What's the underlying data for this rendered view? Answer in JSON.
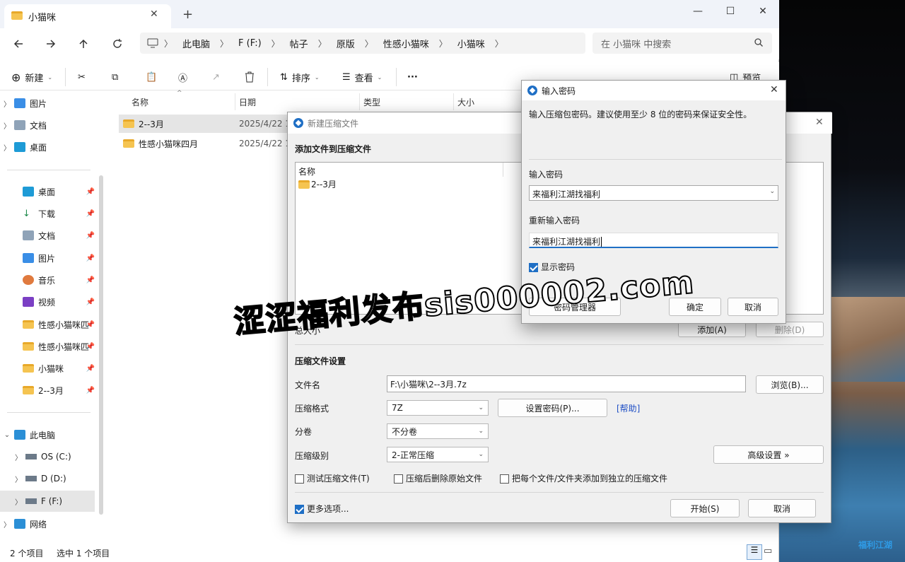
{
  "explorer": {
    "tab_title": "小猫咪",
    "breadcrumb": [
      "此电脑",
      "F (F:)",
      "帖子",
      "原版",
      "性感小猫咪",
      "小猫咪"
    ],
    "search_placeholder": "在 小猫咪 中搜索",
    "toolbar": {
      "new_label": "新建",
      "sort_label": "排序",
      "view_label": "查看",
      "more_label": "···",
      "preview_label": "预览"
    },
    "nav_top": [
      "图片",
      "文档",
      "桌面"
    ],
    "quick_access": [
      "桌面",
      "下载",
      "文档",
      "图片",
      "音乐",
      "视频",
      "性感小猫咪匹",
      "性感小猫咪匹",
      "小猫咪",
      "2--3月"
    ],
    "this_pc": {
      "label": "此电脑",
      "drives": [
        "OS (C:)",
        "D (D:)",
        "F (F:)"
      ],
      "network": "网络"
    },
    "columns": [
      "名称",
      "日期",
      "类型",
      "大小"
    ],
    "files": [
      {
        "name": "2--3月",
        "date": "2025/4/22 1"
      },
      {
        "name": "性感小猫咪四月",
        "date": "2025/4/22 1"
      }
    ],
    "status_count": "2 个项目",
    "status_selected": "选中 1 个项目"
  },
  "compress_dialog": {
    "title": "新建压缩文件",
    "heading": "添加文件到压缩文件",
    "list_header": "名称",
    "list_items": [
      "2--3月"
    ],
    "total_label": "总大小",
    "add_button": "添加(A)",
    "remove_button": "删除(D)",
    "settings_heading": "压缩文件设置",
    "filename_label": "文件名",
    "filename_value": "F:\\小猫咪\\2--3月.7z",
    "browse_button": "浏览(B)...",
    "format_label": "压缩格式",
    "format_value": "7Z",
    "set_password_button": "设置密码(P)...",
    "help_link": "[帮助]",
    "volume_label": "分卷",
    "volume_value": "不分卷",
    "level_label": "压缩级别",
    "level_value": "2-正常压缩",
    "advanced_button": "高级设置 »",
    "opt_test": "测试压缩文件(T)",
    "opt_delete": "压缩后删除原始文件",
    "opt_separate": "把每个文件/文件夹添加到独立的压缩文件",
    "more_options": "更多选项...",
    "start_button": "开始(S)",
    "cancel_button": "取消"
  },
  "password_dialog": {
    "title": "输入密码",
    "description": "输入压缩包密码。建议使用至少 8 位的密码来保证安全性。",
    "enter_label": "输入密码",
    "enter_value": "来福利江湖找福利",
    "reenter_label": "重新输入密码",
    "reenter_value": "来福利江湖找福利",
    "show_password": "显示密码",
    "manager_button": "密码管理器",
    "ok_button": "确定",
    "cancel_button": "取消"
  },
  "watermark": "涩涩福利发布sis000002.com",
  "desktop_logo": "福利江湖",
  "colors": {
    "accent": "#1f6fc5",
    "folder": "#f5c451",
    "selection": "#e5e5e5"
  }
}
